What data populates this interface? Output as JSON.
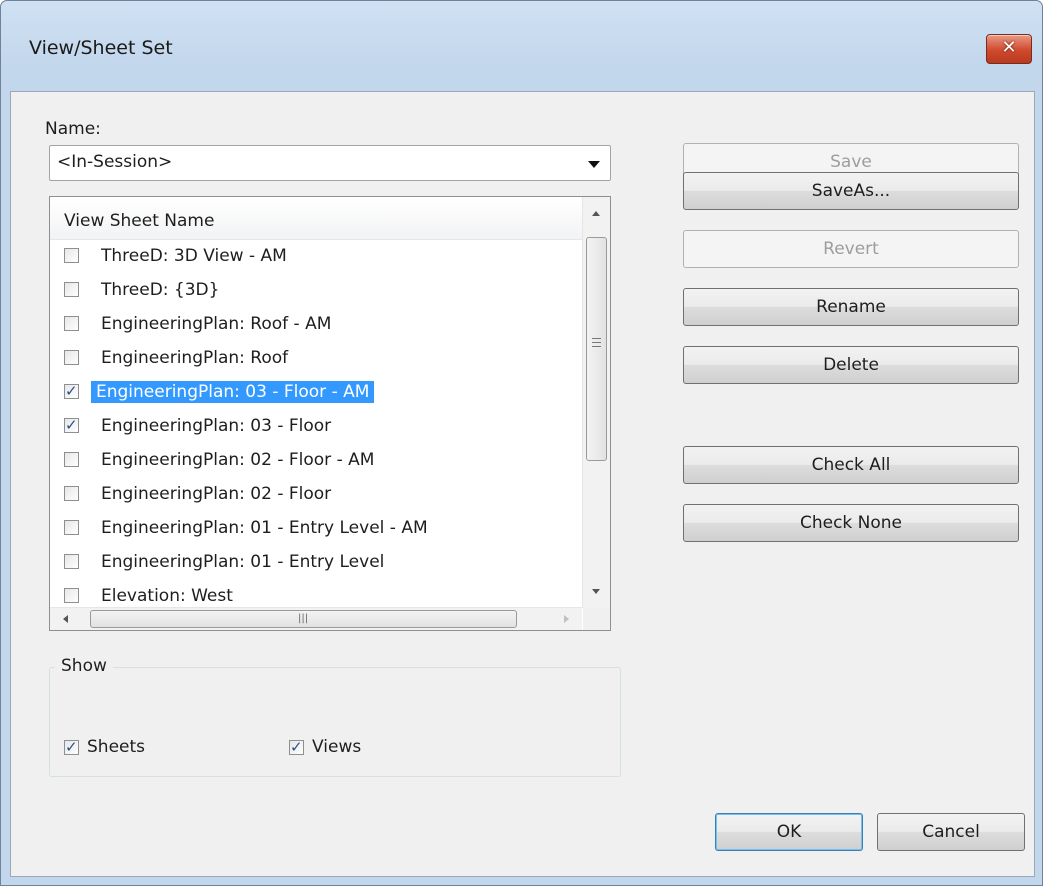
{
  "window": {
    "title": "View/Sheet Set"
  },
  "name_field": {
    "label": "Name:",
    "value": "<In-Session>"
  },
  "list": {
    "header": "View Sheet Name",
    "items": [
      {
        "label": "ThreeD: 3D View - AM",
        "checked": false,
        "selected": false
      },
      {
        "label": "ThreeD: {3D}",
        "checked": false,
        "selected": false
      },
      {
        "label": "EngineeringPlan: Roof - AM",
        "checked": false,
        "selected": false
      },
      {
        "label": "EngineeringPlan: Roof",
        "checked": false,
        "selected": false
      },
      {
        "label": "EngineeringPlan: 03 - Floor - AM",
        "checked": true,
        "selected": true
      },
      {
        "label": "EngineeringPlan: 03 - Floor",
        "checked": true,
        "selected": false
      },
      {
        "label": "EngineeringPlan: 02 - Floor - AM",
        "checked": false,
        "selected": false
      },
      {
        "label": "EngineeringPlan: 02 - Floor",
        "checked": false,
        "selected": false
      },
      {
        "label": "EngineeringPlan: 01 - Entry Level - AM",
        "checked": false,
        "selected": false
      },
      {
        "label": "EngineeringPlan: 01 - Entry Level",
        "checked": false,
        "selected": false
      },
      {
        "label": "Elevation: West",
        "checked": false,
        "selected": false
      }
    ]
  },
  "show": {
    "legend": "Show",
    "sheets": {
      "label": "Sheets",
      "checked": true
    },
    "views": {
      "label": "Views",
      "checked": true
    }
  },
  "buttons": {
    "save": "Save",
    "save_as": "SaveAs...",
    "revert": "Revert",
    "rename": "Rename",
    "delete": "Delete",
    "check_all": "Check All",
    "check_none": "Check None",
    "ok": "OK",
    "cancel": "Cancel"
  },
  "colors": {
    "selection": "#3399ff",
    "title_bar": "#c2d6ec",
    "close_button": "#d0492c"
  },
  "icons": {
    "close": "close-icon",
    "dropdown": "chevron-down-icon"
  }
}
